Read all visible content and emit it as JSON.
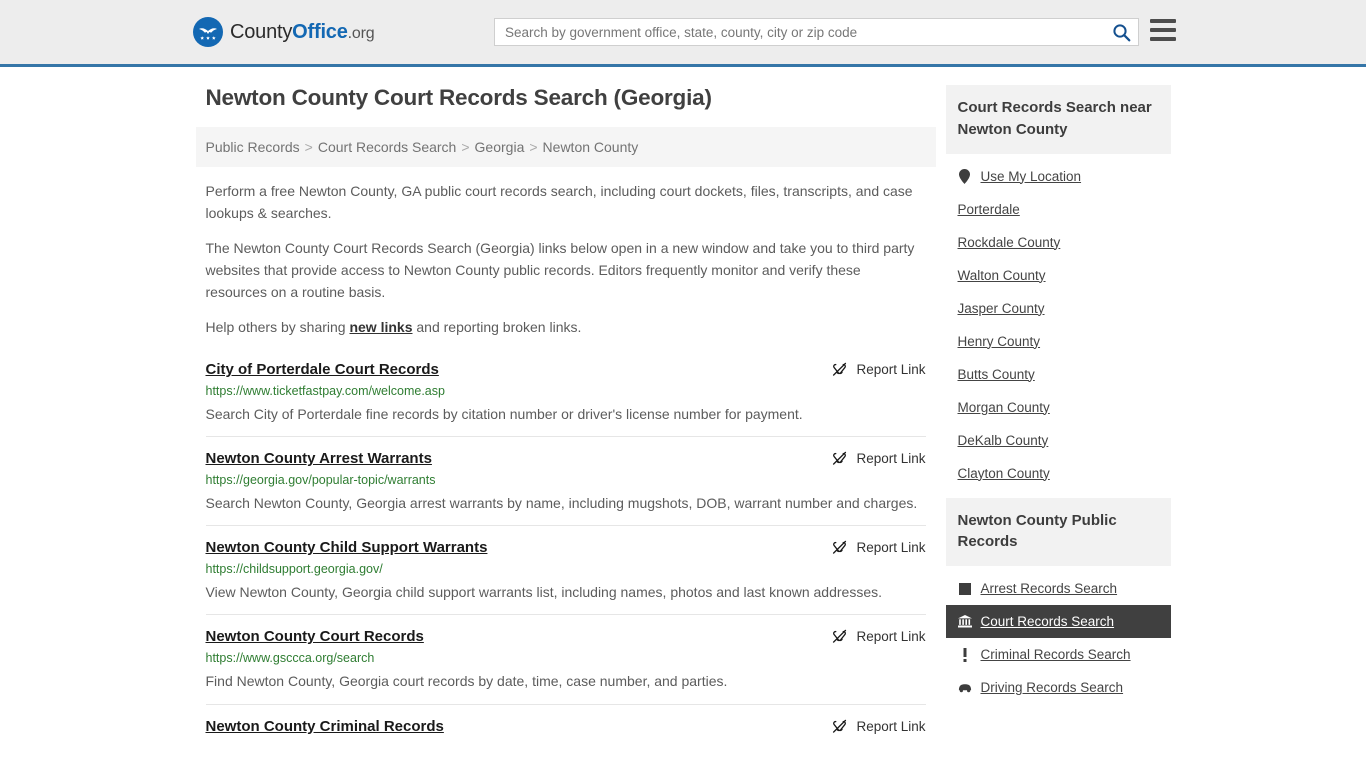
{
  "header": {
    "logo": {
      "part1": "County",
      "part2": "Office",
      "tld": ".org",
      "icon": "eagle-shield-logo"
    },
    "search": {
      "placeholder": "Search by government office, state, county, city or zip code",
      "value": "",
      "icon": "search-icon"
    },
    "menu_icon": "hamburger-menu-icon"
  },
  "page": {
    "title": "Newton County Court Records Search (Georgia)"
  },
  "breadcrumb": {
    "separator": ">",
    "items": [
      {
        "label": "Public Records"
      },
      {
        "label": "Court Records Search"
      },
      {
        "label": "Georgia"
      },
      {
        "label": "Newton County"
      }
    ]
  },
  "intro": {
    "p1": "Perform a free Newton County, GA public court records search, including court dockets, files, transcripts, and case lookups & searches.",
    "p2": "The Newton County Court Records Search (Georgia) links below open in a new window and take you to third party websites that provide access to Newton County public records. Editors frequently monitor and verify these resources on a routine basis.",
    "p3_before": "Help others by sharing ",
    "p3_link": "new links",
    "p3_after": " and reporting broken links."
  },
  "report_link": {
    "label": "Report Link",
    "icon": "broken-link-icon"
  },
  "results": [
    {
      "title": "City of Porterdale Court Records",
      "url": "https://www.ticketfastpay.com/welcome.asp",
      "description": "Search City of Porterdale fine records by citation number or driver's license number for payment."
    },
    {
      "title": "Newton County Arrest Warrants",
      "url": "https://georgia.gov/popular-topic/warrants",
      "description": "Search Newton County, Georgia arrest warrants by name, including mugshots, DOB, warrant number and charges."
    },
    {
      "title": "Newton County Child Support Warrants",
      "url": "https://childsupport.georgia.gov/",
      "description": "View Newton County, Georgia child support warrants list, including names, photos and last known addresses."
    },
    {
      "title": "Newton County Court Records",
      "url": "https://www.gsccca.org/search",
      "description": "Find Newton County, Georgia court records by date, time, case number, and parties."
    },
    {
      "title": "Newton County Criminal Records",
      "url": "",
      "description": ""
    }
  ],
  "sidebar": {
    "nearby": {
      "heading": "Court Records Search near Newton County",
      "items": [
        {
          "label": "Use My Location",
          "icon": "location-pin-icon"
        },
        {
          "label": "Porterdale",
          "icon": ""
        },
        {
          "label": "Rockdale County",
          "icon": ""
        },
        {
          "label": "Walton County",
          "icon": ""
        },
        {
          "label": "Jasper County",
          "icon": ""
        },
        {
          "label": "Henry County",
          "icon": ""
        },
        {
          "label": "Butts County",
          "icon": ""
        },
        {
          "label": "Morgan County",
          "icon": ""
        },
        {
          "label": "DeKalb County",
          "icon": ""
        },
        {
          "label": "Clayton County",
          "icon": ""
        }
      ]
    },
    "public_records": {
      "heading": "Newton County Public Records",
      "items": [
        {
          "label": "Arrest Records Search",
          "icon": "handcuffs-icon",
          "active": false
        },
        {
          "label": "Court Records Search",
          "icon": "courthouse-icon",
          "active": true
        },
        {
          "label": "Criminal Records Search",
          "icon": "exclamation-icon",
          "active": false
        },
        {
          "label": "Driving Records Search",
          "icon": "car-icon",
          "active": false
        }
      ]
    }
  },
  "colors": {
    "header_bg": "#ededed",
    "header_border": "#3576a8",
    "brand_blue": "#1368b3",
    "url_green": "#2f7d32",
    "active_bg": "#404040",
    "panel_bg": "#f2f2f2"
  }
}
